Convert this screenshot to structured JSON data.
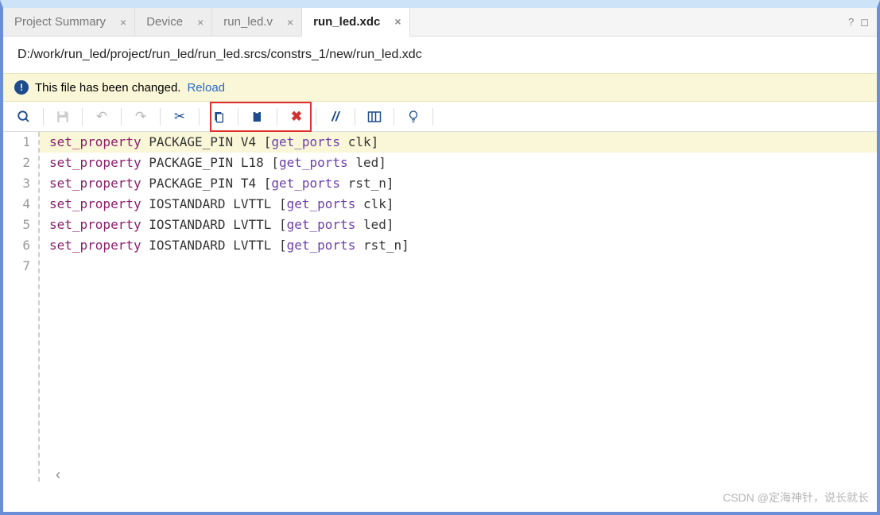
{
  "tabs": {
    "t0": "Project Summary",
    "t1": "Device",
    "t2": "run_led.v",
    "t3": "run_led.xdc"
  },
  "help_icon": "?",
  "maximize_icon": "◻",
  "path": "D:/work/run_led/project/run_led/run_led.srcs/constrs_1/new/run_led.xdc",
  "notify": {
    "msg": "This file has been changed. ",
    "link": "Reload"
  },
  "icons": {
    "search": "🔍",
    "save": "💾",
    "undo": "↶",
    "redo": "↷",
    "cut": "✂",
    "copy": "📄",
    "paste": "📋",
    "delete": "✖",
    "comment": "//",
    "columns": "▥",
    "bulb": "💡"
  },
  "lines": {
    "n1": "1",
    "n2": "2",
    "n3": "3",
    "n4": "4",
    "n5": "5",
    "n6": "6",
    "n7": "7"
  },
  "code": {
    "cmd": "set_property",
    "get": "get_ports",
    "l1p": " PACKAGE_PIN V4 [",
    "l1a": " clk]",
    "l2p": " PACKAGE_PIN L18 [",
    "l2a": " led]",
    "l3p": " PACKAGE_PIN T4 [",
    "l3a": " rst_n]",
    "l4p": " IOSTANDARD LVTTL [",
    "l4a": " clk]",
    "l5p": " IOSTANDARD LVTTL [",
    "l5a": " led]",
    "l6p": " IOSTANDARD LVTTL [",
    "l6a": " rst_n]"
  },
  "watermark": "CSDN @定海神针，说长就长"
}
